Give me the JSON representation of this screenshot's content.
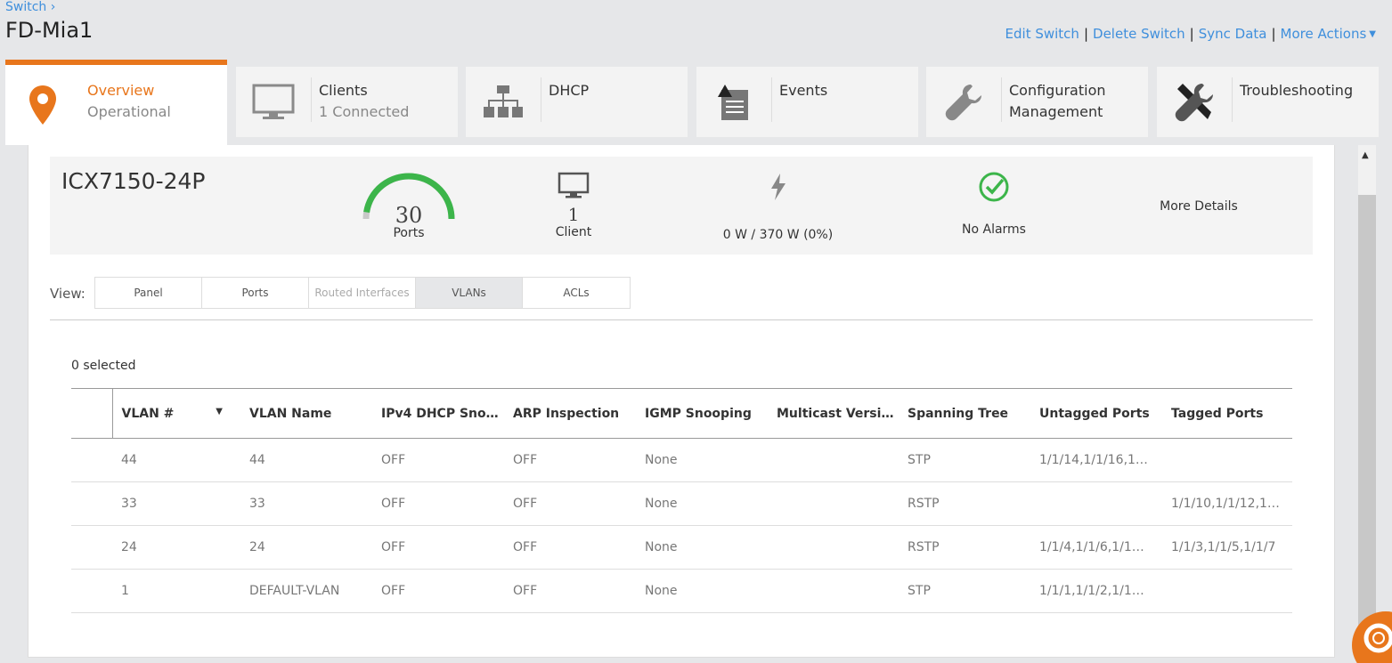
{
  "breadcrumb": "Switch",
  "title": "FD-Mia1",
  "actions": {
    "edit": "Edit Switch",
    "delete": "Delete Switch",
    "sync": "Sync Data",
    "more": "More Actions"
  },
  "tabs": [
    {
      "label": "Overview",
      "sub": "Operational",
      "icon": "map-pin-icon"
    },
    {
      "label": "Clients",
      "sub": "1 Connected",
      "icon": "monitor-icon"
    },
    {
      "label": "DHCP",
      "sub": "",
      "icon": "network-tree-icon"
    },
    {
      "label": "Events",
      "sub": "",
      "icon": "event-log-icon"
    },
    {
      "label": "Configuration",
      "sub": "Management",
      "icon": "wrench-icon"
    },
    {
      "label": "Troubleshooting",
      "sub": "",
      "icon": "tools-icon"
    }
  ],
  "summary": {
    "model": "ICX7150-24P",
    "ports_count": "30",
    "ports_label": "Ports",
    "ports_gauge_fraction": 0.05,
    "clients_count": "1",
    "clients_label": "Client",
    "power": "0 W / 370 W (0%)",
    "alarms": "No Alarms",
    "more_details": "More Details"
  },
  "view": {
    "label": "View:",
    "options": [
      "Panel",
      "Ports",
      "Routed Interfaces",
      "VLANs",
      "ACLs"
    ],
    "selected": "VLANs"
  },
  "selected_count": "0 selected",
  "table": {
    "headers": [
      "VLAN #",
      "VLAN Name",
      "IPv4 DHCP Sno…",
      "ARP Inspection",
      "IGMP Snooping",
      "Multicast Version",
      "Spanning Tree",
      "Untagged Ports",
      "Tagged Ports"
    ],
    "rows": [
      [
        "44",
        "44",
        "OFF",
        "OFF",
        "None",
        "",
        "STP",
        "1/1/14,1/1/16,1…",
        ""
      ],
      [
        "33",
        "33",
        "OFF",
        "OFF",
        "None",
        "",
        "RSTP",
        "",
        "1/1/10,1/1/12,1…"
      ],
      [
        "24",
        "24",
        "OFF",
        "OFF",
        "None",
        "",
        "RSTP",
        "1/1/4,1/1/6,1/1…",
        "1/1/3,1/1/5,1/1/7"
      ],
      [
        "1",
        "DEFAULT-VLAN",
        "OFF",
        "OFF",
        "None",
        "",
        "STP",
        "1/1/1,1/1/2,1/1…",
        ""
      ]
    ]
  },
  "colors": {
    "accent": "#e8761c",
    "link": "#3f8fdc",
    "ok": "#3cb54a"
  }
}
